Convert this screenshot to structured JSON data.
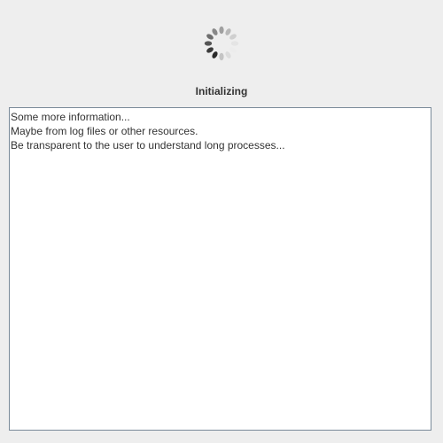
{
  "status": {
    "label": "Initializing"
  },
  "spinner": {
    "icon": "loading-spinner-icon",
    "segment_colors": [
      "#3a3a3a",
      "#555555",
      "#6e6e6e",
      "#888888",
      "#a0a0a0",
      "#b8b8b8",
      "#cfcfcf",
      "#e4e4e4",
      "#ececec",
      "#dcdcdc",
      "#c4c4c4",
      "#2a2a2a"
    ]
  },
  "log": {
    "lines": [
      "Some more information...",
      "Maybe from log files or other resources.",
      "Be transparent to the user to understand long processes..."
    ]
  }
}
